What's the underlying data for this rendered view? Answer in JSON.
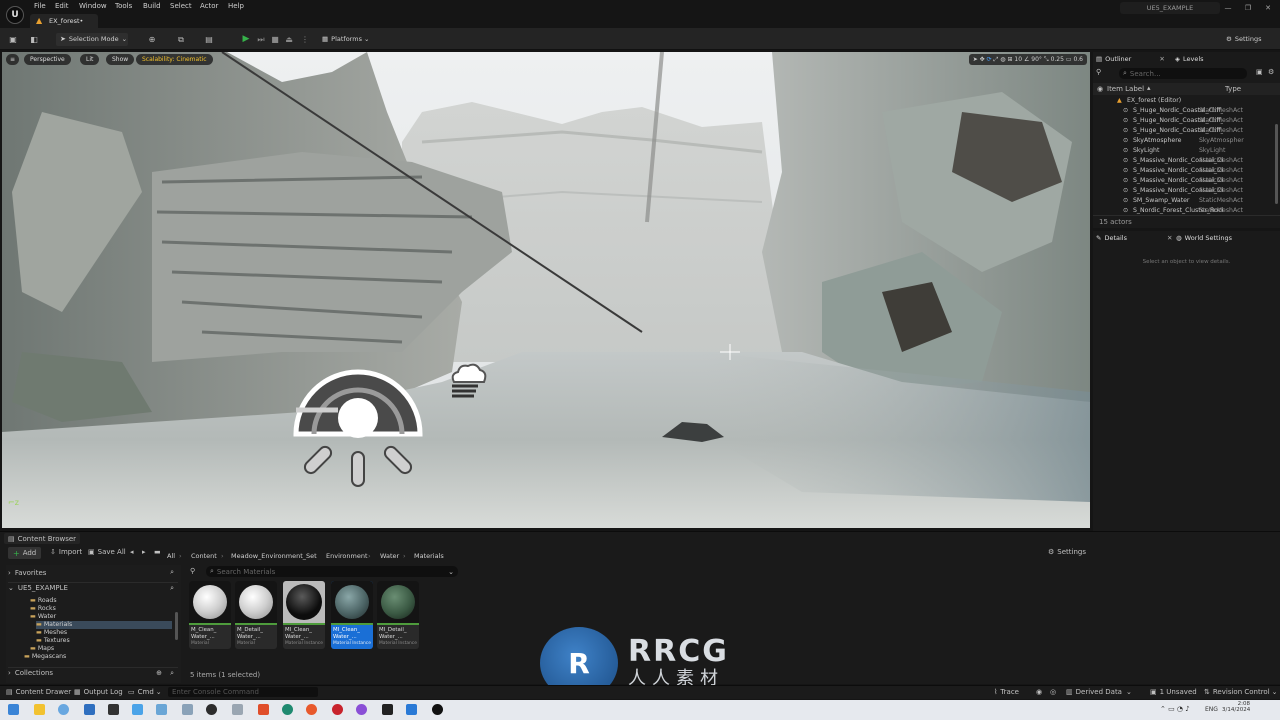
{
  "app": {
    "level_tab": "EX_forest•",
    "project": "UE5_EXAMPLE"
  },
  "menu": [
    "File",
    "Edit",
    "Window",
    "Tools",
    "Build",
    "Select",
    "Actor",
    "Help"
  ],
  "toolbar": {
    "selection_mode": "Selection Mode",
    "platforms": "Platforms",
    "settings": "Settings"
  },
  "viewport": {
    "perspective": "Perspective",
    "lit": "Lit",
    "show": "Show",
    "scalability": "Scalability: Cinematic",
    "grid_snap": "10",
    "rotation_snap": "90°",
    "scale_snap": "0.25",
    "camera_speed": "0.6"
  },
  "outliner": {
    "tab": "Outliner",
    "levels_tab": "Levels",
    "search_placeholder": "Search...",
    "col_label": "Item Label",
    "col_type": "Type",
    "root": "EX_forest (Editor)",
    "items": [
      {
        "label": "S_Huge_Nordic_Coastal_Cliff_",
        "type": "StaticMeshAct"
      },
      {
        "label": "S_Huge_Nordic_Coastal_Cliff_",
        "type": "StaticMeshAct"
      },
      {
        "label": "S_Huge_Nordic_Coastal_Cliff_",
        "type": "StaticMeshAct"
      },
      {
        "label": "SkyAtmosphere",
        "type": "SkyAtmospher"
      },
      {
        "label": "SkyLight",
        "type": "SkyLight"
      },
      {
        "label": "S_Massive_Nordic_Coastal_Cli",
        "type": "StaticMeshAct"
      },
      {
        "label": "S_Massive_Nordic_Coastal_Cli",
        "type": "StaticMeshAct"
      },
      {
        "label": "S_Massive_Nordic_Coastal_Cli",
        "type": "StaticMeshAct"
      },
      {
        "label": "S_Massive_Nordic_Coastal_Cli",
        "type": "StaticMeshAct"
      },
      {
        "label": "SM_Swamp_Water",
        "type": "StaticMeshAct"
      },
      {
        "label": "S_Nordic_Forest_Cluster_Rock",
        "type": "StaticMeshAct"
      }
    ],
    "count": "15 actors"
  },
  "details": {
    "tab": "Details",
    "world_settings_tab": "World Settings",
    "empty_text": "Select an object to view details."
  },
  "content_browser": {
    "tab": "Content Browser",
    "add": "Add",
    "import": "Import",
    "save_all": "Save All",
    "settings": "Settings",
    "breadcrumb": [
      "All",
      "Content",
      "Meadow_Environment_Set",
      "Environment",
      "Water",
      "Materials"
    ],
    "favorites": "Favorites",
    "project": "UE5_EXAMPLE",
    "tree": [
      "Roads",
      "Rocks",
      "Water",
      "Materials",
      "Meshes",
      "Textures",
      "Maps",
      "Megascans"
    ],
    "collections": "Collections",
    "search_placeholder": "Search Materials",
    "assets": [
      {
        "name": "M_Clean_\nWater_...",
        "type": "Material"
      },
      {
        "name": "M_Detail_\nWater_...",
        "type": "Material"
      },
      {
        "name": "MI_Clean_\nWater_...",
        "type": "Material Instance"
      },
      {
        "name": "MI_Clean_\nWater_...",
        "type": "Material Instance"
      },
      {
        "name": "MI_Detail_\nWater_...",
        "type": "Material Instance"
      }
    ],
    "status": "5 items (1 selected)"
  },
  "bottom_bar": {
    "content_drawer": "Content Drawer",
    "output_log": "Output Log",
    "cmd": "Cmd",
    "console_placeholder": "Enter Console Command",
    "trace": "Trace",
    "derived_data": "Derived Data",
    "unsaved": "1 Unsaved",
    "revision_control": "Revision Control"
  },
  "taskbar": {
    "lang": "ENG",
    "time": "2:08",
    "date": "3/14/2024"
  },
  "watermark": {
    "logo_text": "RRCG",
    "sub_text": "人人素材"
  },
  "colors": {
    "accent_blue": "#1a6fd6",
    "play_green": "#36b24a",
    "material_green": "#4e9c3c",
    "scalability_yellow": "#f3c12c"
  }
}
